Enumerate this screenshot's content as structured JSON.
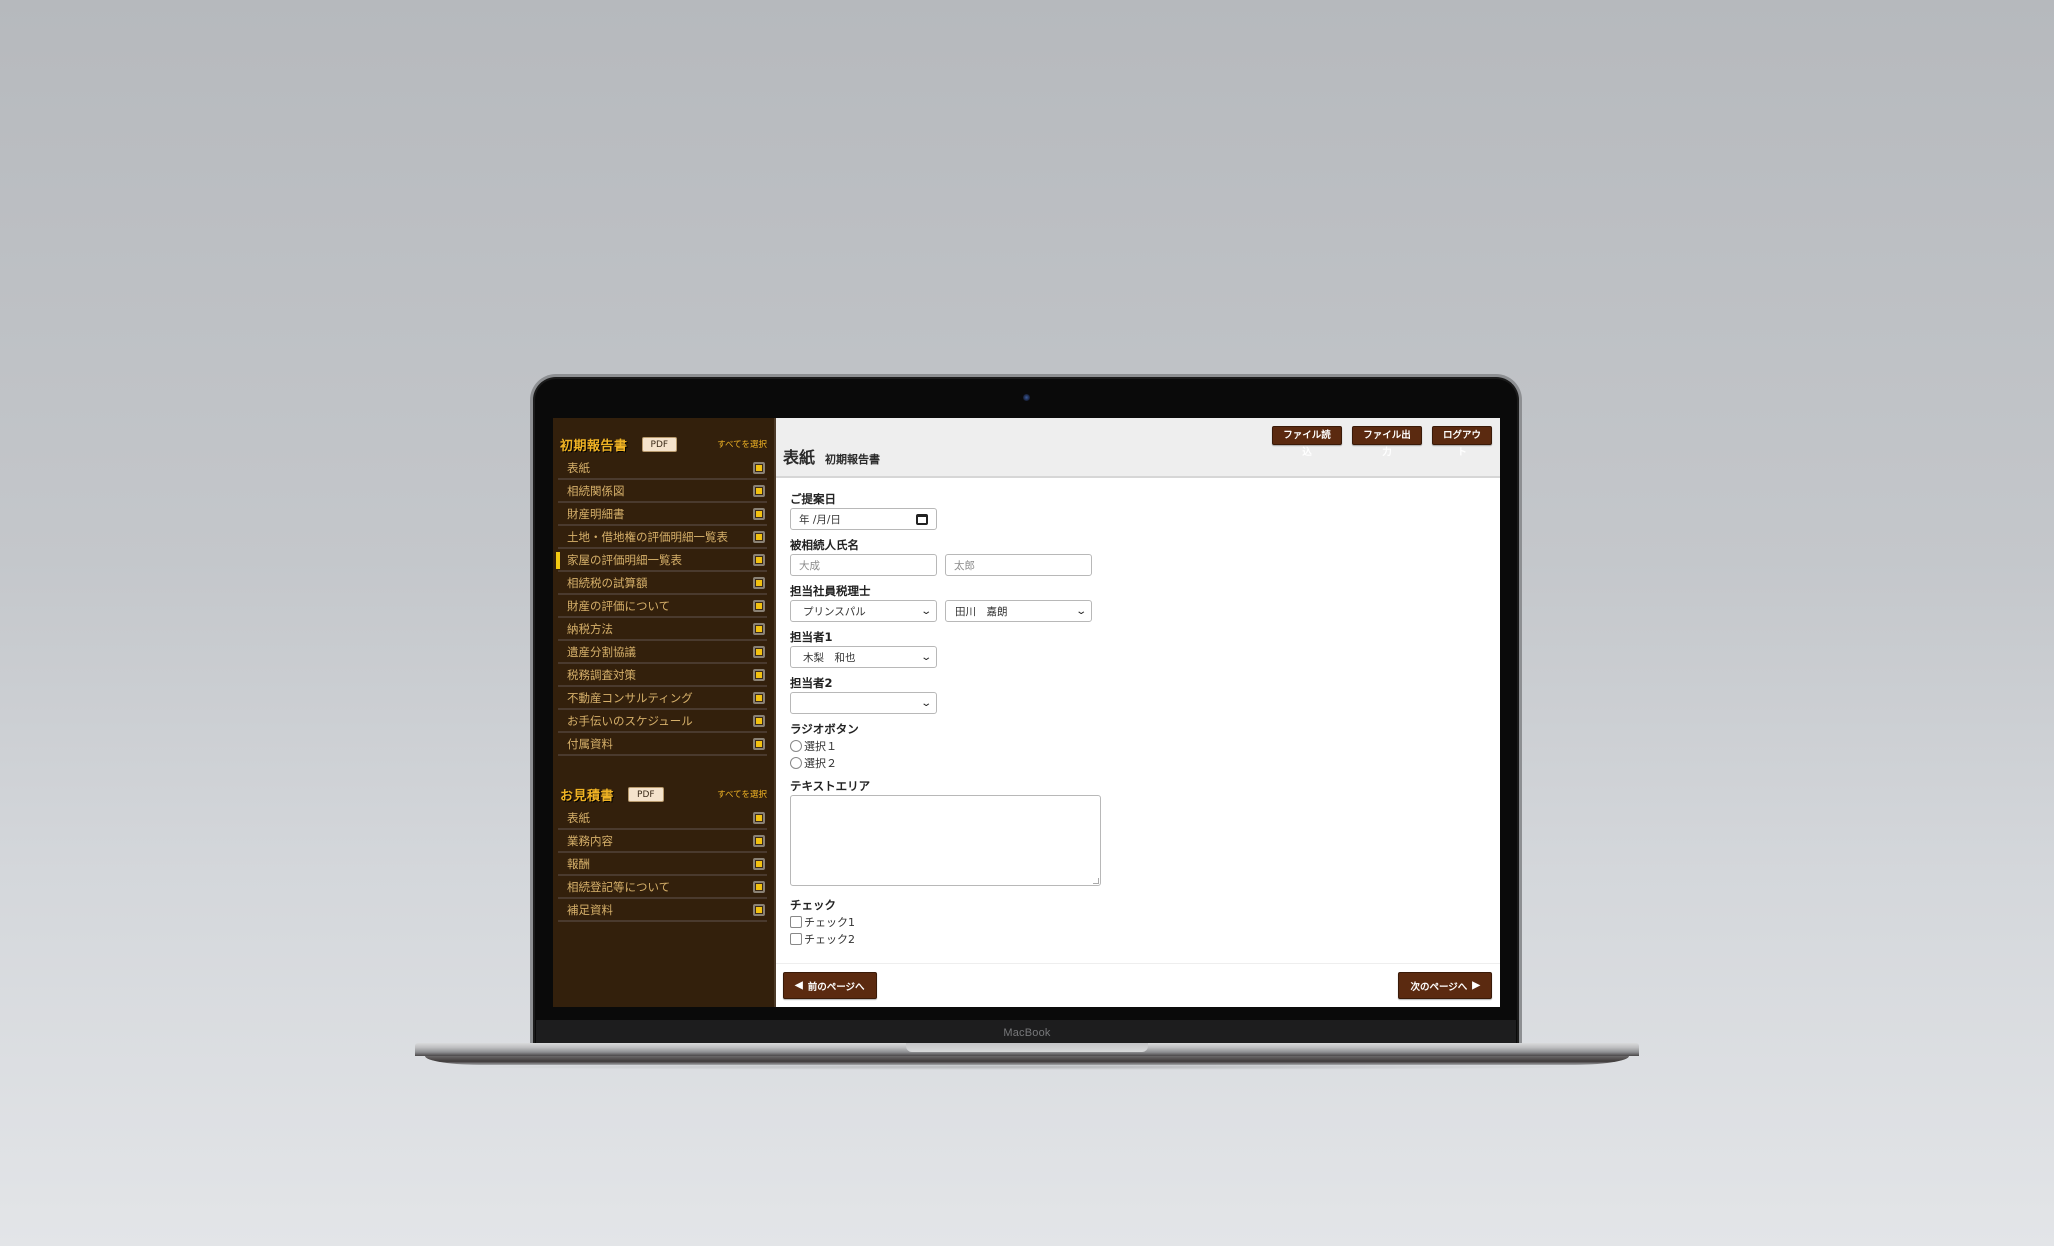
{
  "device": {
    "label": "MacBook"
  },
  "sidebar": {
    "sections": [
      {
        "title": "初期報告書",
        "pdf_label": "PDF",
        "select_all_label": "すべてを選択",
        "items": [
          {
            "label": "表紙",
            "checked": true,
            "active": false
          },
          {
            "label": "相続関係図",
            "checked": true,
            "active": false
          },
          {
            "label": "財産明細書",
            "checked": true,
            "active": false
          },
          {
            "label": "土地・借地権の評価明細一覧表",
            "checked": true,
            "active": false
          },
          {
            "label": "家屋の評価明細一覧表",
            "checked": true,
            "active": true
          },
          {
            "label": "相続税の試算額",
            "checked": true,
            "active": false
          },
          {
            "label": "財産の評価について",
            "checked": true,
            "active": false
          },
          {
            "label": "納税方法",
            "checked": true,
            "active": false
          },
          {
            "label": "遺産分割協議",
            "checked": true,
            "active": false
          },
          {
            "label": "税務調査対策",
            "checked": true,
            "active": false
          },
          {
            "label": "不動産コンサルティング",
            "checked": true,
            "active": false
          },
          {
            "label": "お手伝いのスケジュール",
            "checked": true,
            "active": false
          },
          {
            "label": "付属資料",
            "checked": true,
            "active": false
          }
        ]
      },
      {
        "title": "お見積書",
        "pdf_label": "PDF",
        "select_all_label": "すべてを選択",
        "items": [
          {
            "label": "表紙",
            "checked": true,
            "active": false
          },
          {
            "label": "業務内容",
            "checked": true,
            "active": false
          },
          {
            "label": "報酬",
            "checked": true,
            "active": false
          },
          {
            "label": "相続登記等について",
            "checked": true,
            "active": false
          },
          {
            "label": "補足資料",
            "checked": true,
            "active": false
          }
        ]
      }
    ]
  },
  "header": {
    "title": "表紙",
    "subtitle": "初期報告書",
    "buttons": {
      "file_import": "ファイル読込",
      "file_export": "ファイル出力",
      "logout": "ログアウト"
    }
  },
  "form": {
    "proposal_date": {
      "label": "ご提案日",
      "value": "年 /月/日"
    },
    "decedent_name": {
      "label": "被相続人氏名",
      "last_placeholder": "大成",
      "first_placeholder": "太郎"
    },
    "tax_accountant": {
      "label": "担当社員税理士",
      "select1_value": "プリンスパル",
      "select2_value": "田川　嘉朗"
    },
    "staff1": {
      "label": "担当者1",
      "value": "木梨　和也"
    },
    "staff2": {
      "label": "担当者2",
      "value": ""
    },
    "radio": {
      "label": "ラジオボタン",
      "options": [
        "選択１",
        "選択２"
      ]
    },
    "textarea": {
      "label": "テキストエリア",
      "value": ""
    },
    "check": {
      "label": "チェック",
      "options": [
        "チェック1",
        "チェック2"
      ]
    }
  },
  "footer": {
    "prev_label": "前のページへ",
    "next_label": "次のページへ"
  },
  "colors": {
    "sidebar_bg": "#33200c",
    "accent_gold": "#f0b324",
    "button_brown": "#5b2a10",
    "header_bg": "#eeeeee"
  }
}
